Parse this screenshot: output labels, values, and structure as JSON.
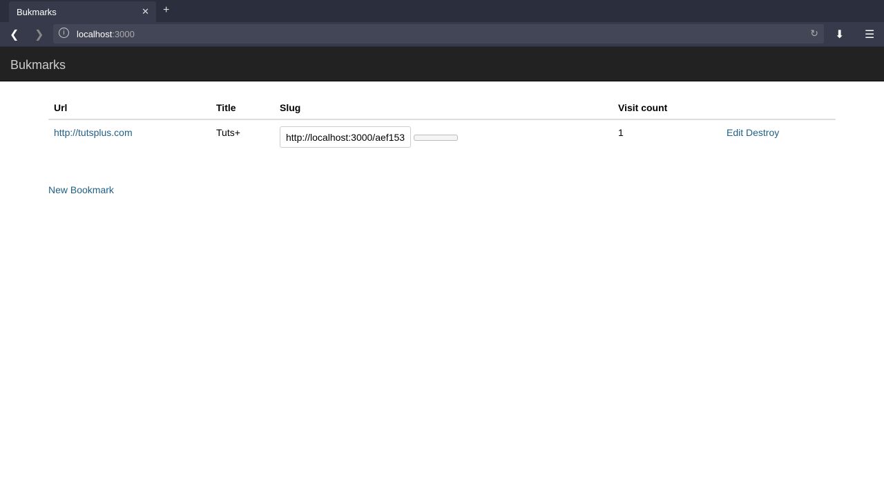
{
  "browser": {
    "tab_title": "Bukmarks",
    "url_host": "localhost",
    "url_port": ":3000"
  },
  "app": {
    "brand": "Bukmarks"
  },
  "table": {
    "headers": [
      "Url",
      "Title",
      "Slug",
      "Visit count",
      ""
    ],
    "rows": [
      {
        "url": "http://tutsplus.com",
        "title": "Tuts+",
        "slug": "http://localhost:3000/aef153",
        "visit_count": "1",
        "edit": "Edit",
        "destroy": "Destroy"
      }
    ]
  },
  "new_bookmark": "New Bookmark"
}
